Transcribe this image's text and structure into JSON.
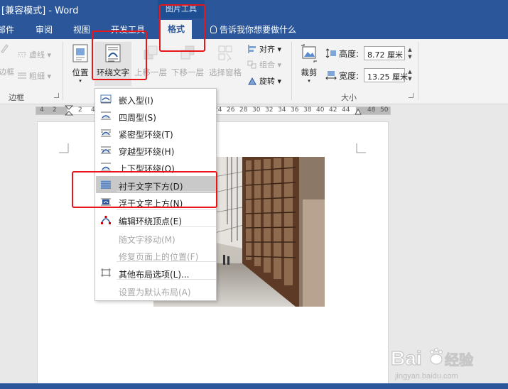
{
  "window": {
    "title": "[兼容模式] - Word",
    "context_tab_group": "图片工具"
  },
  "tabs": [
    {
      "label": "邮件"
    },
    {
      "label": "审阅"
    },
    {
      "label": "视图"
    },
    {
      "label": "开发工具"
    },
    {
      "label": "格式",
      "active": true
    }
  ],
  "tell_me": "告诉我你想要做什么",
  "ribbon": {
    "border_group": {
      "label": "边框",
      "border_btn": "边框",
      "dash_btn": "虚线",
      "weight_btn": "粗细"
    },
    "arrange_group": {
      "position": "位置",
      "wrap_text": "环绕文字",
      "bring_forward": "上移一层",
      "send_backward": "下移一层",
      "selection_pane": "选择窗格",
      "align": "对齐",
      "group": "组合",
      "rotate": "旋转"
    },
    "size_group": {
      "label": "大小",
      "crop": "裁剪",
      "height_label": "高度:",
      "height_value": "8.72 厘米",
      "width_label": "宽度:",
      "width_value": "13.25 厘米"
    }
  },
  "ruler": {
    "ticks": [
      "4",
      "2",
      "",
      "2",
      "4",
      "24",
      "26",
      "28",
      "30",
      "32",
      "34",
      "36",
      "38",
      "40",
      "42",
      "44",
      "",
      "48",
      "50"
    ]
  },
  "wrap_menu": {
    "items": [
      {
        "label": "嵌入型(I)",
        "icon": "inline-wrap-icon",
        "enabled": true
      },
      {
        "label": "四周型(S)",
        "icon": "square-wrap-icon",
        "enabled": true
      },
      {
        "label": "紧密型环绕(T)",
        "icon": "tight-wrap-icon",
        "enabled": true
      },
      {
        "label": "穿越型环绕(H)",
        "icon": "through-wrap-icon",
        "enabled": true
      },
      {
        "label": "上下型环绕(O)",
        "icon": "top-bottom-wrap-icon",
        "enabled": true
      },
      {
        "label": "衬于文字下方(D)",
        "icon": "behind-text-icon",
        "enabled": true,
        "highlighted": true
      },
      {
        "label": "浮于文字上方(N)",
        "icon": "in-front-text-icon",
        "enabled": true
      },
      {
        "label": "编辑环绕顶点(E)",
        "icon": "edit-wrap-points-icon",
        "enabled": true
      },
      {
        "label": "随文字移动(M)",
        "enabled": false
      },
      {
        "label": "修复页面上的位置(F)",
        "enabled": false
      },
      {
        "label": "其他布局选项(L)...",
        "icon": "layout-options-icon",
        "enabled": true
      },
      {
        "label": "设置为默认布局(A)",
        "enabled": false
      }
    ]
  },
  "watermark": {
    "brand": "Bai",
    "brand2": "经验",
    "url": "jingyan.baidu.com"
  },
  "colors": {
    "ribbon_blue": "#2b579a",
    "annotation_red": "#e8161b",
    "menu_highlight": "#c9c9c9"
  }
}
